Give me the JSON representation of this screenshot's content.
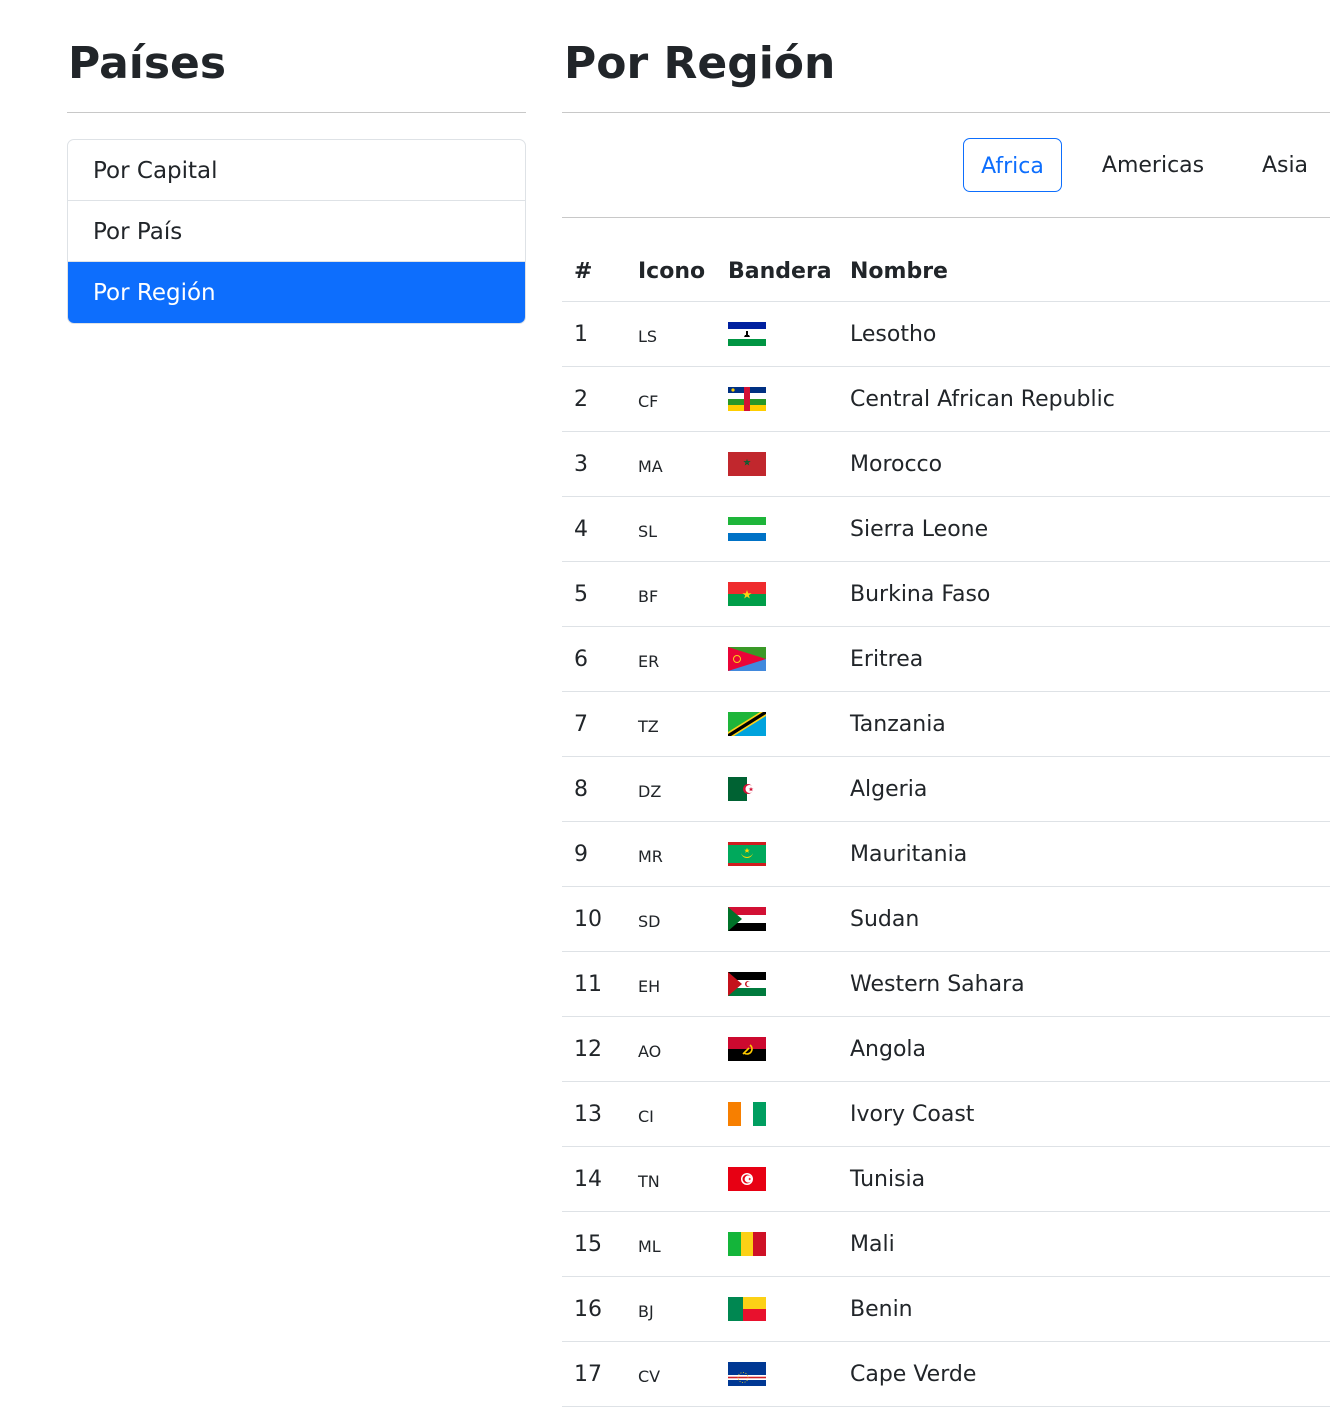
{
  "sidebar": {
    "title": "Países",
    "menu": [
      {
        "label": "Por Capital",
        "active": false
      },
      {
        "label": "Por País",
        "active": false
      },
      {
        "label": "Por Región",
        "active": true
      }
    ]
  },
  "main": {
    "title": "Por Región",
    "regions": [
      {
        "label": "Africa",
        "active": true
      },
      {
        "label": "Americas",
        "active": false
      },
      {
        "label": "Asia",
        "active": false
      }
    ],
    "table": {
      "headers": [
        "#",
        "Icono",
        "Bandera",
        "Nombre"
      ],
      "rows": [
        {
          "num": "1",
          "code": "LS",
          "name": "Lesotho",
          "flag": "flag-ls"
        },
        {
          "num": "2",
          "code": "CF",
          "name": "Central African Republic",
          "flag": "flag-cf"
        },
        {
          "num": "3",
          "code": "MA",
          "name": "Morocco",
          "flag": "flag-ma"
        },
        {
          "num": "4",
          "code": "SL",
          "name": "Sierra Leone",
          "flag": "flag-sl"
        },
        {
          "num": "5",
          "code": "BF",
          "name": "Burkina Faso",
          "flag": "flag-bf"
        },
        {
          "num": "6",
          "code": "ER",
          "name": "Eritrea",
          "flag": "flag-er"
        },
        {
          "num": "7",
          "code": "TZ",
          "name": "Tanzania",
          "flag": "flag-tz"
        },
        {
          "num": "8",
          "code": "DZ",
          "name": "Algeria",
          "flag": "flag-dz"
        },
        {
          "num": "9",
          "code": "MR",
          "name": "Mauritania",
          "flag": "flag-mr"
        },
        {
          "num": "10",
          "code": "SD",
          "name": "Sudan",
          "flag": "flag-sd"
        },
        {
          "num": "11",
          "code": "EH",
          "name": "Western Sahara",
          "flag": "flag-eh"
        },
        {
          "num": "12",
          "code": "AO",
          "name": "Angola",
          "flag": "flag-ao"
        },
        {
          "num": "13",
          "code": "CI",
          "name": "Ivory Coast",
          "flag": "flag-ci"
        },
        {
          "num": "14",
          "code": "TN",
          "name": "Tunisia",
          "flag": "flag-tn"
        },
        {
          "num": "15",
          "code": "ML",
          "name": "Mali",
          "flag": "flag-ml"
        },
        {
          "num": "16",
          "code": "BJ",
          "name": "Benin",
          "flag": "flag-bj"
        },
        {
          "num": "17",
          "code": "CV",
          "name": "Cape Verde",
          "flag": "flag-cv"
        }
      ]
    }
  },
  "colors": {
    "accent": "#0d6efd",
    "text": "#212529",
    "border": "#dee2e6"
  }
}
